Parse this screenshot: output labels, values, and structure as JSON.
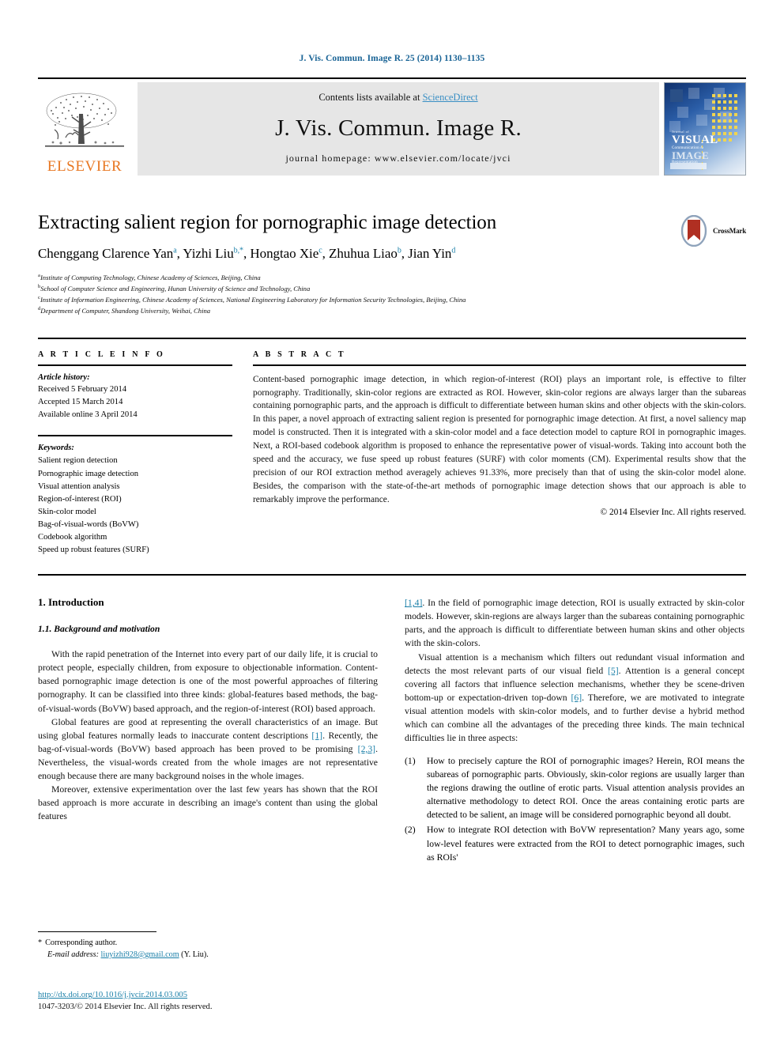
{
  "running_head": "J. Vis. Commun. Image R. 25 (2014) 1130–1135",
  "masthead": {
    "contents_prefix": "Contents lists available at ",
    "sciencedirect": "ScienceDirect",
    "journal_title": "J. Vis. Commun. Image R.",
    "homepage": "journal homepage: www.elsevier.com/locate/jvci",
    "publisher_wordmark": "ELSEVIER",
    "cover": {
      "kicker": "Journal of",
      "line1": "VISUAL",
      "line2": "Communication &",
      "line3": "IMAGE",
      "line4": "Representation"
    },
    "accent_link_color": "#3a8fc4",
    "elsevier_orange": "#E87722"
  },
  "crossmark": {
    "label": "CrossMark"
  },
  "title": "Extracting salient region for pornographic image detection",
  "authors": [
    {
      "name": "Chenggang Clarence Yan",
      "sup": "a",
      "sep": ", "
    },
    {
      "name": "Yizhi Liu",
      "sup": "b,*",
      "sep": ", "
    },
    {
      "name": "Hongtao Xie",
      "sup": "c",
      "sep": ", "
    },
    {
      "name": "Zhuhua Liao",
      "sup": "b",
      "sep": ", "
    },
    {
      "name": "Jian Yin",
      "sup": "d",
      "sep": ""
    }
  ],
  "affiliations": [
    {
      "mark": "a",
      "text": "Institute of Computing Technology, Chinese Academy of Sciences, Beijing, China"
    },
    {
      "mark": "b",
      "text": "School of Computer Science and Engineering, Hunan University of Science and Technology, China"
    },
    {
      "mark": "c",
      "text": "Institute of Information Engineering, Chinese Academy of Sciences, National Engineering Laboratory for Information Security Technologies, Beijing, China"
    },
    {
      "mark": "d",
      "text": "Department of Computer, Shandong University, Weihai, China"
    }
  ],
  "article_info": {
    "heading": "A R T I C L E   I N F O",
    "history_label": "Article history:",
    "history": [
      "Received 5 February 2014",
      "Accepted 15 March 2014",
      "Available online 3 April 2014"
    ],
    "keywords_label": "Keywords:",
    "keywords": [
      "Salient region detection",
      "Pornographic image detection",
      "Visual attention analysis",
      "Region-of-interest (ROI)",
      "Skin-color model",
      "Bag-of-visual-words (BoVW)",
      "Codebook algorithm",
      "Speed up robust features (SURF)"
    ]
  },
  "abstract": {
    "heading": "A B S T R A C T",
    "text": "Content-based pornographic image detection, in which region-of-interest (ROI) plays an important role, is effective to filter pornography. Traditionally, skin-color regions are extracted as ROI. However, skin-color regions are always larger than the subareas containing pornographic parts, and the approach is difficult to differentiate between human skins and other objects with the skin-colors. In this paper, a novel approach of extracting salient region is presented for pornographic image detection. At first, a novel saliency map model is constructed. Then it is integrated with a skin-color model and a face detection model to capture ROI in pornographic images. Next, a ROI-based codebook algorithm is proposed to enhance the representative power of visual-words. Taking into account both the speed and the accuracy, we fuse speed up robust features (SURF) with color moments (CM). Experimental results show that the precision of our ROI extraction method averagely achieves 91.33%, more precisely than that of using the skin-color model alone. Besides, the comparison with the state-of-the-art methods of pornographic image detection shows that our approach is able to remarkably improve the performance.",
    "copyright": "© 2014 Elsevier Inc. All rights reserved."
  },
  "body": {
    "section_heading": "1. Introduction",
    "subsection_heading": "1.1. Background and motivation",
    "left_paragraphs": [
      "With the rapid penetration of the Internet into every part of our daily life, it is crucial to protect people, especially children, from exposure to objectionable information. Content-based pornographic image detection is one of the most powerful approaches of filtering pornography. It can be classified into three kinds: global-features based methods, the bag-of-visual-words (BoVW) based approach, and the region-of-interest (ROI) based approach.",
      "Global features are good at representing the overall characteristics of an image. But using global features normally leads to inaccurate content descriptions [1]. Recently, the bag-of-visual-words (BoVW) based approach has been proved to be promising [2,3]. Nevertheless, the visual-words created from the whole images are not representative enough because there are many background noises in the whole images.",
      "Moreover, extensive experimentation over the last few years has shown that the ROI based approach is more accurate in describing an image's content than using the global features"
    ],
    "right_paragraphs": [
      "[1,4]. In the field of pornographic image detection, ROI is usually extracted by skin-color models. However, skin-regions are always larger than the subareas containing pornographic parts, and the approach is difficult to differentiate between human skins and other objects with the skin-colors.",
      "Visual attention is a mechanism which filters out redundant visual information and detects the most relevant parts of our visual field [5]. Attention is a general concept covering all factors that influence selection mechanisms, whether they be scene-driven bottom-up or expectation-driven top-down [6]. Therefore, we are motivated to integrate visual attention models with skin-color models, and to further devise a hybrid method which can combine all the advantages of the preceding three kinds. The main technical difficulties lie in three aspects:"
    ],
    "numbered_items": [
      {
        "num": "(1)",
        "text": "How to precisely capture the ROI of pornographic images? Herein, ROI means the subareas of pornographic parts. Obviously, skin-color regions are usually larger than the regions drawing the outline of erotic parts. Visual attention analysis provides an alternative methodology to detect ROI. Once the areas containing erotic parts are detected to be salient, an image will be considered pornographic beyond all doubt."
      },
      {
        "num": "(2)",
        "text": "How to integrate ROI detection with BoVW representation? Many years ago, some low-level features were extracted from the ROI to detect pornographic images, such as ROIs'"
      }
    ]
  },
  "footnote": {
    "corresponding_star": "*",
    "corresponding_label": "Corresponding author.",
    "email_label": "E-mail address:",
    "email": "liuyizhi928@gmail.com",
    "email_owner": "(Y. Liu).",
    "doi": "http://dx.doi.org/10.1016/j.jvcir.2014.03.005",
    "issn": "1047-3203/© 2014 Elsevier Inc. All rights reserved."
  }
}
